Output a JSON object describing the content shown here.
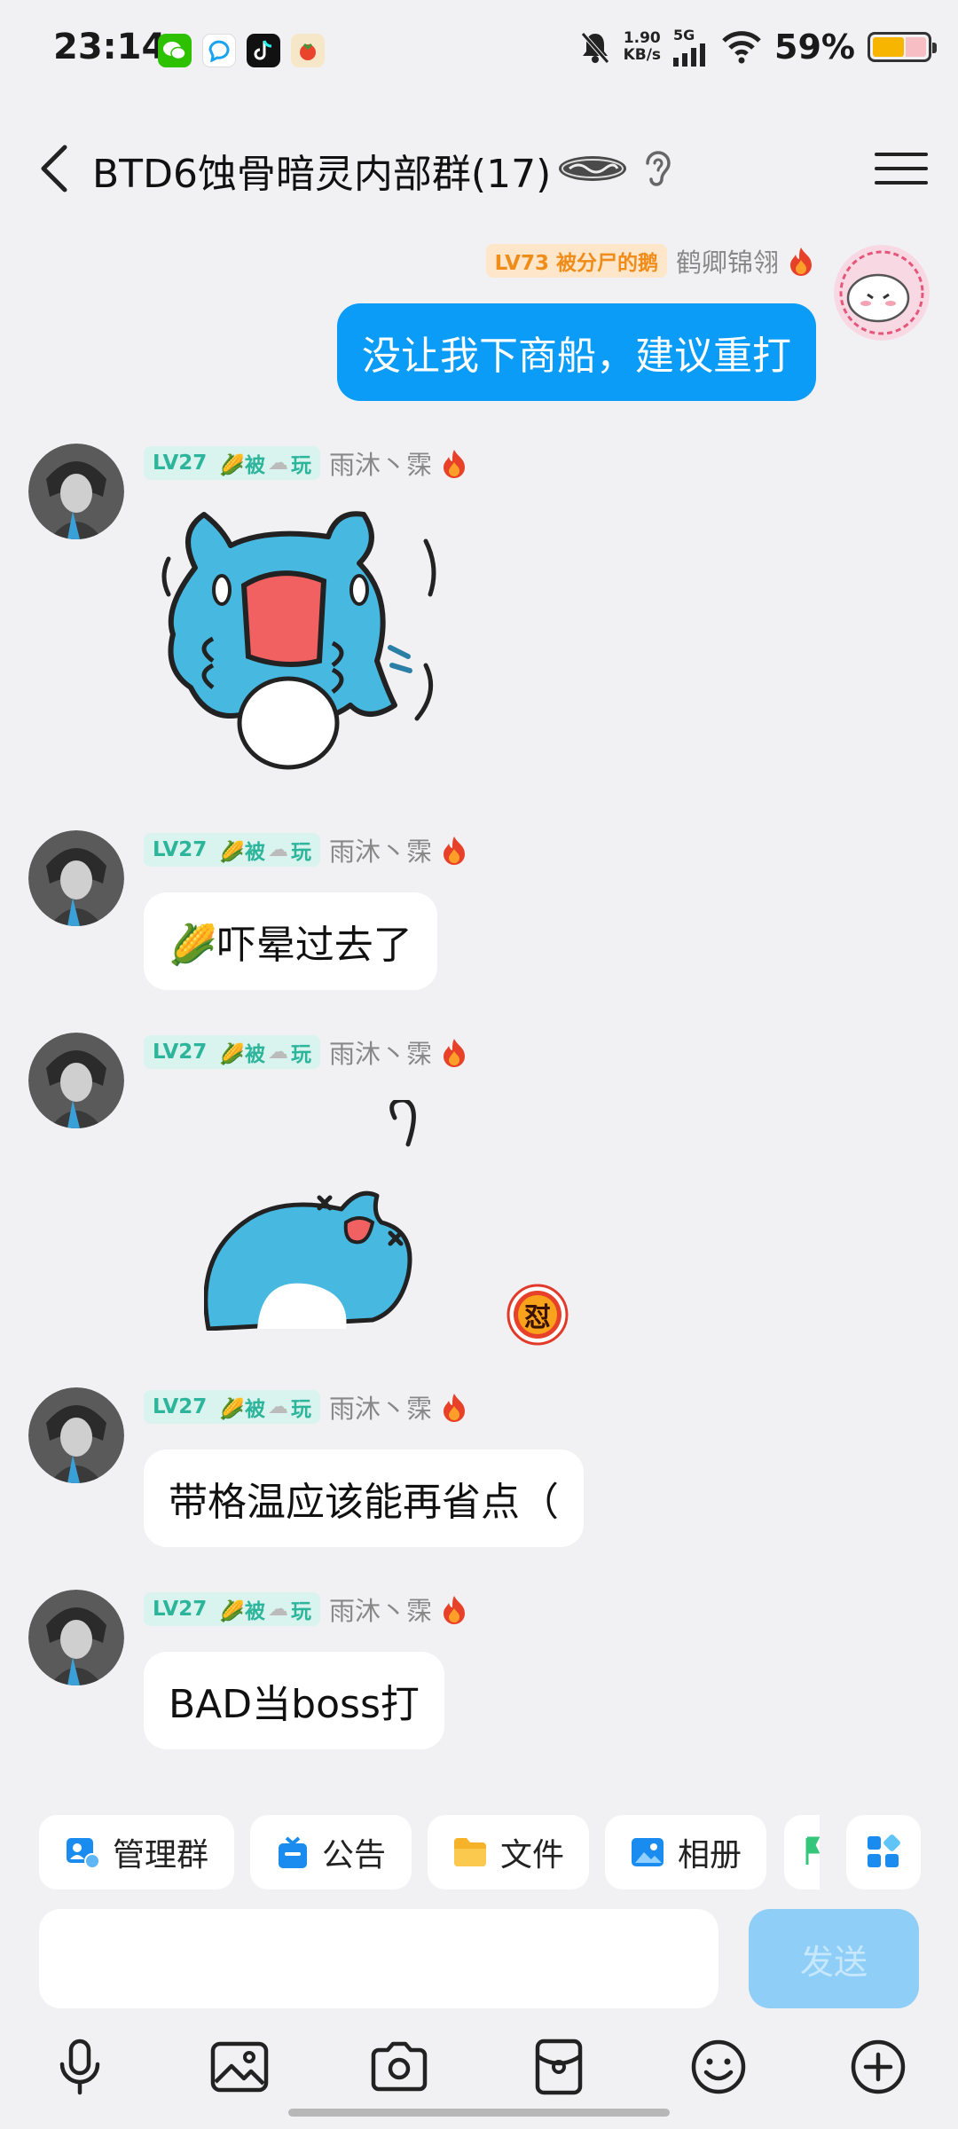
{
  "status_bar": {
    "time": "23:14",
    "net_speed_value": "1.90",
    "net_speed_unit": "KB/s",
    "network": "5G",
    "battery_percent": "59%",
    "battery_level": 0.59,
    "notification_apps": [
      "wechat-icon",
      "qq-icon",
      "tiktok-icon",
      "tomato-icon"
    ]
  },
  "header": {
    "title": "BTD6蚀骨暗灵内部群(17)",
    "badge_icon": "group-badge-icon"
  },
  "messages": [
    {
      "sender": "鹤卿锦翎",
      "level": "LV73 被分尸的鹅",
      "is_self": true,
      "type": "text",
      "text": "没让我下商船，建议重打"
    },
    {
      "sender": "雨沐丶霂",
      "level": "LV27",
      "title_text": "🌽被",
      "title_suffix": "玩",
      "type": "sticker",
      "sticker": "shocked-blue-cat-sticker"
    },
    {
      "sender": "雨沐丶霂",
      "level": "LV27",
      "title_text": "🌽被",
      "title_suffix": "玩",
      "type": "text",
      "text": "🌽吓晕过去了"
    },
    {
      "sender": "雨沐丶霂",
      "level": "LV27",
      "title_text": "🌽被",
      "title_suffix": "玩",
      "type": "sticker",
      "sticker": "fainted-blue-cat-sticker",
      "reaction": "怼"
    },
    {
      "sender": "雨沐丶霂",
      "level": "LV27",
      "title_text": "🌽被",
      "title_suffix": "玩",
      "type": "text",
      "text": "带格温应该能再省点（"
    },
    {
      "sender": "雨沐丶霂",
      "level": "LV27",
      "title_text": "🌽被",
      "title_suffix": "玩",
      "type": "text",
      "text": "BAD当boss打"
    }
  ],
  "toolbar": {
    "items": [
      {
        "label": "管理群",
        "icon": "manage-group-icon"
      },
      {
        "label": "公告",
        "icon": "announcement-icon"
      },
      {
        "label": "文件",
        "icon": "folder-icon"
      },
      {
        "label": "相册",
        "icon": "album-icon"
      }
    ]
  },
  "composer": {
    "placeholder": "",
    "send_label": "发送"
  },
  "bottom_icons": [
    "microphone-icon",
    "image-icon",
    "camera-icon",
    "red-packet-icon",
    "emoji-icon",
    "plus-icon"
  ],
  "colors": {
    "accent_blue": "#0a9cf7",
    "level_teal": "#2cb59b",
    "level_orange": "#f08c1a",
    "background": "#f1f1f3"
  }
}
